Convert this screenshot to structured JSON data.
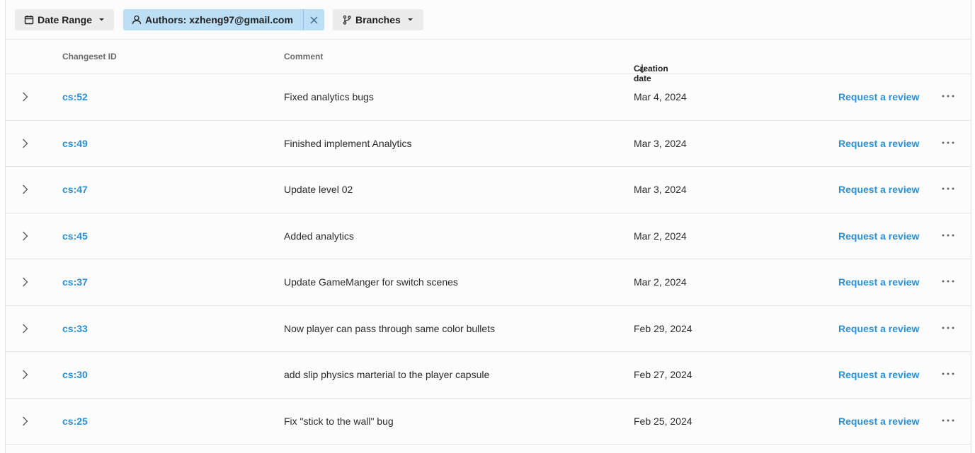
{
  "filters": {
    "date_range_label": "Date Range",
    "authors_label": "Authors: xzheng97@gmail.com",
    "branches_label": "Branches"
  },
  "table": {
    "columns": {
      "changeset_id": "Changeset ID",
      "comment": "Comment",
      "creation_date": "Creation date"
    },
    "sort": {
      "column": "creation_date",
      "direction": "descending"
    },
    "rows": [
      {
        "id": "cs:52",
        "comment": "Fixed analytics bugs",
        "date": "Mar 4, 2024",
        "action": "Request a review"
      },
      {
        "id": "cs:49",
        "comment": "Finished implement Analytics",
        "date": "Mar 3, 2024",
        "action": "Request a review"
      },
      {
        "id": "cs:47",
        "comment": "Update level 02",
        "date": "Mar 3, 2024",
        "action": "Request a review"
      },
      {
        "id": "cs:45",
        "comment": "Added analytics",
        "date": "Mar 2, 2024",
        "action": "Request a review"
      },
      {
        "id": "cs:37",
        "comment": "Update GameManger for switch scenes",
        "date": "Mar 2, 2024",
        "action": "Request a review"
      },
      {
        "id": "cs:33",
        "comment": "Now player can pass through same color bullets",
        "date": "Feb 29, 2024",
        "action": "Request a review"
      },
      {
        "id": "cs:30",
        "comment": "add slip physics marterial to the player capsule",
        "date": "Feb 27, 2024",
        "action": "Request a review"
      },
      {
        "id": "cs:25",
        "comment": "Fix \"stick to the wall\" bug",
        "date": "Feb 25, 2024",
        "action": "Request a review"
      }
    ]
  },
  "colors": {
    "link": "#2d8fd5",
    "active_filter_bg": "#bcdff6",
    "filter_bg": "#ececec"
  },
  "icons": {
    "date_range": "calendar-icon",
    "authors": "user-icon",
    "branches": "branch-icon",
    "clear": "close-icon",
    "dropdown": "caret-down-icon",
    "sort": "arrow-down-icon",
    "expand": "chevron-right-icon",
    "more": "more-horizontal-icon"
  }
}
